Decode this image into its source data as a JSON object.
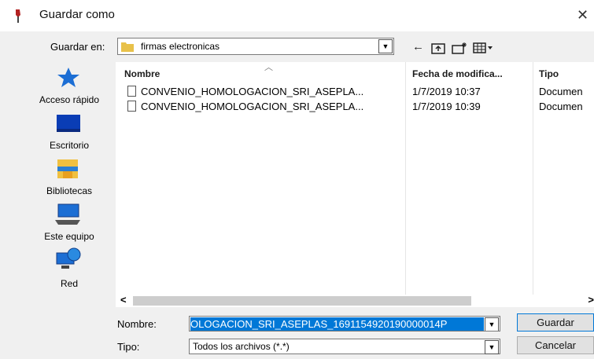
{
  "window": {
    "title": "Guardar como",
    "close_glyph": "✕"
  },
  "toolbar": {
    "save_in_label": "Guardar en:",
    "folder": "firmas electronicas",
    "back_glyph": "←",
    "up_glyph": "⬆",
    "new_folder_glyph": "✳",
    "view_glyph": "▦▾"
  },
  "places": [
    {
      "label": "Acceso rápido",
      "icon": "star-icon"
    },
    {
      "label": "Escritorio",
      "icon": "desktop-icon"
    },
    {
      "label": "Bibliotecas",
      "icon": "libraries-icon"
    },
    {
      "label": "Este equipo",
      "icon": "computer-icon"
    },
    {
      "label": "Red",
      "icon": "network-icon"
    }
  ],
  "columns": {
    "name": "Nombre",
    "date": "Fecha de modifica...",
    "type": "Tipo"
  },
  "files": [
    {
      "name": "CONVENIO_HOMOLOGACION_SRI_ASEPLA...",
      "date": "1/7/2019 10:37",
      "type": "Documen"
    },
    {
      "name": "CONVENIO_HOMOLOGACION_SRI_ASEPLA...",
      "date": "1/7/2019 10:39",
      "type": "Documen"
    }
  ],
  "footer": {
    "name_label": "Nombre:",
    "name_value": "OLOGACION_SRI_ASEPLAS_1691154920190000014P",
    "type_label": "Tipo:",
    "type_value": "Todos los archivos (*.*)",
    "save_button": "Guardar",
    "cancel_button": "Cancelar"
  },
  "colors": {
    "selection": "#0078d7",
    "folder": "#e8c14a"
  }
}
